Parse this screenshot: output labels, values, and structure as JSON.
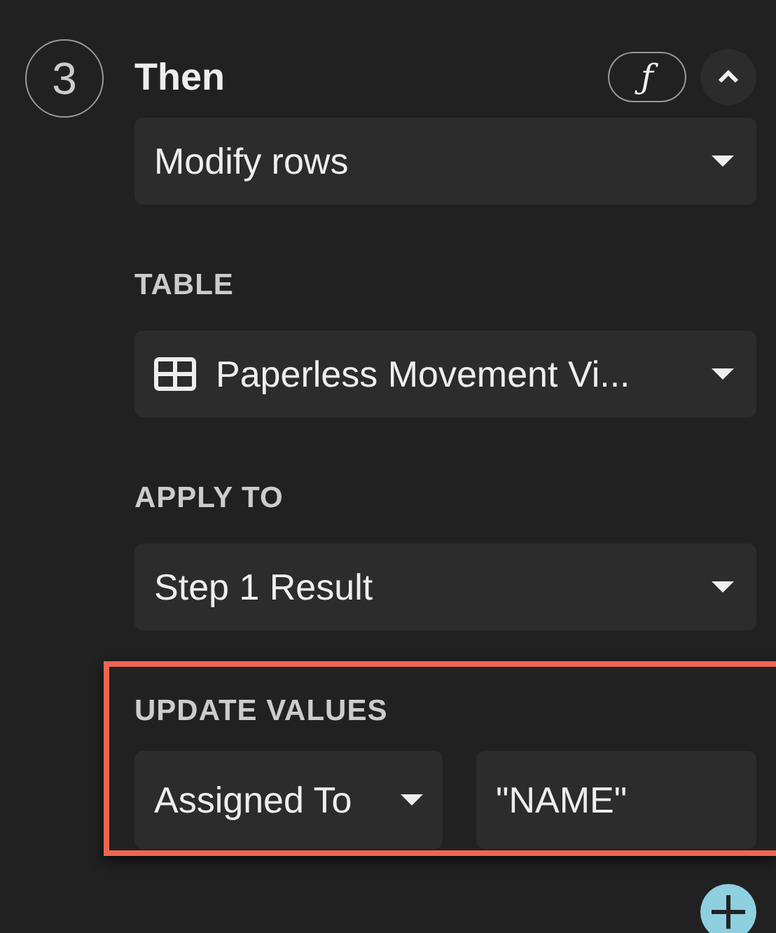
{
  "step": {
    "number": "3",
    "title": "Then",
    "formula_button": "ƒ",
    "expanded": true
  },
  "action": {
    "value": "Modify rows"
  },
  "fields": [
    {
      "label": "TABLE",
      "value": "Paperless Movement Vi...",
      "kind": "table"
    },
    {
      "label": "APPLY TO",
      "value": "Step 1 Result",
      "kind": "plain"
    }
  ],
  "update_values": {
    "label": "UPDATE VALUES",
    "highlighted": true,
    "column": "Assigned To",
    "value": "\"NAME\""
  }
}
